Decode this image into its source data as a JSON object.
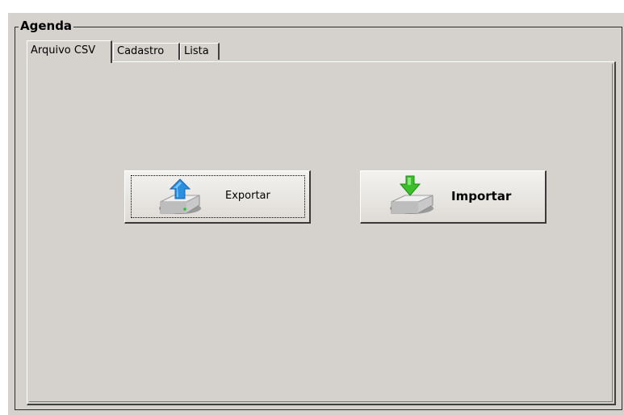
{
  "group": {
    "title": "Agenda"
  },
  "tabs": [
    {
      "label": "Arquivo CSV",
      "active": true
    },
    {
      "label": "Cadastro",
      "active": false
    },
    {
      "label": "Lista",
      "active": false
    }
  ],
  "buttons": {
    "export": {
      "label": "Exportar",
      "icon": "drive-upload-icon"
    },
    "import": {
      "label": "Importar",
      "icon": "drive-download-icon"
    }
  },
  "colors": {
    "face": "#d5d2cd",
    "export_arrow": "#2b8fe0",
    "import_arrow": "#3cbf2a"
  }
}
